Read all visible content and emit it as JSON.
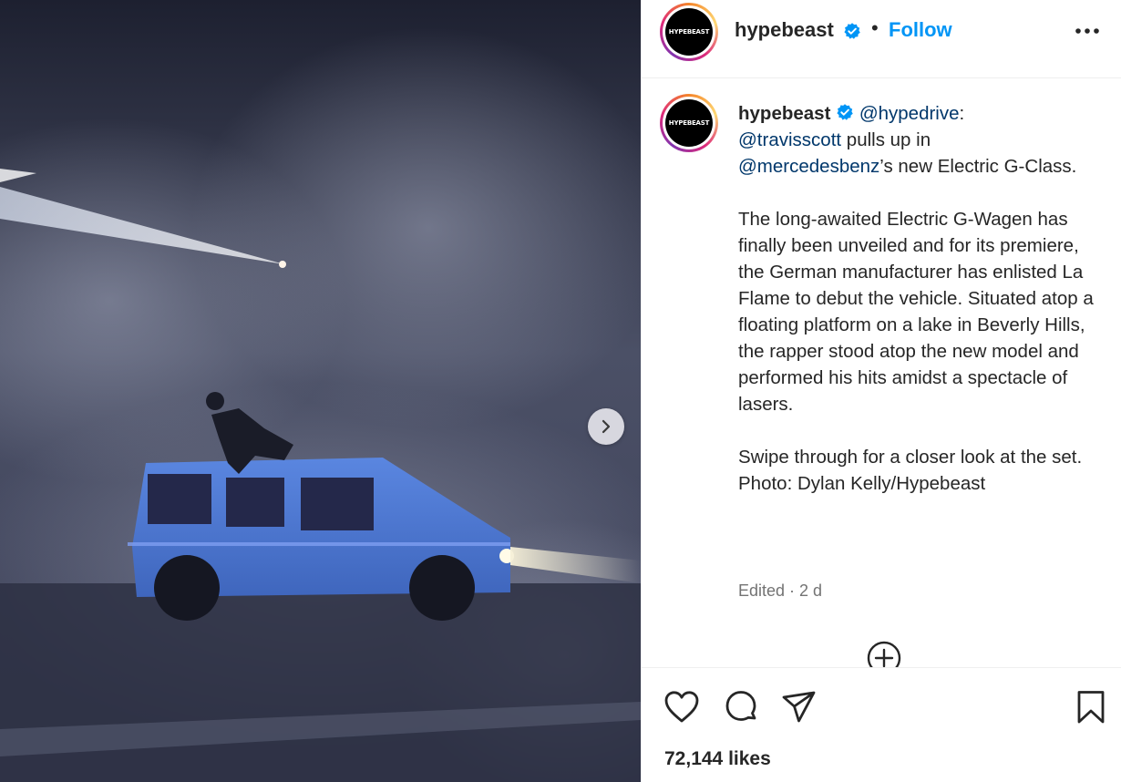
{
  "media": {
    "next_button_icon": "chevron-right-icon"
  },
  "header": {
    "avatar_text": "HYPEBEAST",
    "username": "hypebeast",
    "separator": "•",
    "follow_label": "Follow",
    "more_icon": "more-horizontal-icon"
  },
  "caption": {
    "username": "hypebeast",
    "mention_1": "@hypedrive",
    "after_mention_1": ":",
    "mention_2": "@travisscott",
    "after_mention_2": " pulls up in",
    "mention_3": "@mercedesbenz",
    "after_mention_3": "’s new Electric G-Class.",
    "paragraph_2": "The long-awaited Electric G-Wagen has finally been unveiled and for its premiere, the German manufacturer has enlisted La Flame to debut the vehicle. Situated atop a floating platform on a lake in Beverly Hills, the rapper stood atop the new model and performed his hits amidst a spectacle of lasers.",
    "paragraph_3": "Swipe through for a closer look at the set.",
    "photo_credit": "Photo: Dylan Kelly/Hypebeast",
    "meta": "Edited · 2 d"
  },
  "actions": {
    "like_icon": "heart-icon",
    "comment_icon": "comment-icon",
    "share_icon": "send-icon",
    "save_icon": "bookmark-icon",
    "likes": "72,144 likes"
  },
  "colors": {
    "link_blue": "#0095f6",
    "mention_blue": "#00376b",
    "verified_blue": "#0095f6"
  }
}
